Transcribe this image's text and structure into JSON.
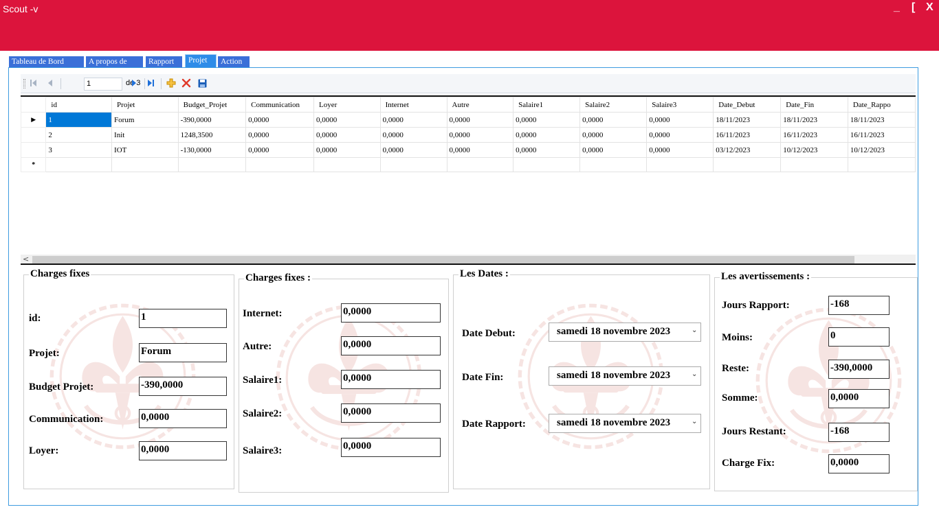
{
  "window": {
    "title": "Scout -v",
    "minimize": "_",
    "restore": "[",
    "close": "X"
  },
  "tabs": [
    {
      "label": "Tableau de Bord"
    },
    {
      "label": "A propos de"
    },
    {
      "label": "Rapport"
    },
    {
      "label": "Projet"
    },
    {
      "label": "Action"
    }
  ],
  "active_tab": "Projet",
  "navigator": {
    "position": "1",
    "of_label": "de 3"
  },
  "grid": {
    "columns": [
      "id",
      "Projet",
      "Budget_Projet",
      "Communication",
      "Loyer",
      "Internet",
      "Autre",
      "Salaire1",
      "Salaire2",
      "Salaire3",
      "Date_Debut",
      "Date_Fin",
      "Date_Rappo"
    ],
    "rows": [
      [
        "1",
        "Forum",
        "-390,0000",
        "0,0000",
        "0,0000",
        "0,0000",
        "0,0000",
        "0,0000",
        "0,0000",
        "0,0000",
        "18/11/2023",
        "18/11/2023",
        "18/11/2023"
      ],
      [
        "2",
        "Init",
        "1248,3500",
        "0,0000",
        "0,0000",
        "0,0000",
        "0,0000",
        "0,0000",
        "0,0000",
        "0,0000",
        "16/11/2023",
        "16/11/2023",
        "16/11/2023"
      ],
      [
        "3",
        "IOT",
        "-130,0000",
        "0,0000",
        "0,0000",
        "0,0000",
        "0,0000",
        "0,0000",
        "0,0000",
        "0,0000",
        "03/12/2023",
        "10/12/2023",
        "10/12/2023"
      ]
    ],
    "current_row_marker": "▶",
    "new_row_marker": "*"
  },
  "group1": {
    "title": "Charges fixes",
    "fields": [
      {
        "label": "id:",
        "value": "1"
      },
      {
        "label": "Projet:",
        "value": "Forum"
      },
      {
        "label": "Budget Projet:",
        "value": "-390,0000"
      },
      {
        "label": "Communication:",
        "value": "0,0000"
      },
      {
        "label": "Loyer:",
        "value": "0,0000"
      }
    ]
  },
  "group2": {
    "title": "Charges fixes :",
    "fields": [
      {
        "label": "Internet:",
        "value": "0,0000"
      },
      {
        "label": "Autre:",
        "value": "0,0000"
      },
      {
        "label": "Salaire1:",
        "value": "0,0000"
      },
      {
        "label": "Salaire2:",
        "value": "0,0000"
      },
      {
        "label": "Salaire3:",
        "value": "0,0000"
      }
    ]
  },
  "group3": {
    "title": "Les Dates :",
    "fields": [
      {
        "label": "Date Debut:",
        "value": "samedi   18 novembre  2023"
      },
      {
        "label": "Date Fin:",
        "value": "samedi   18 novembre  2023"
      },
      {
        "label": "Date Rapport:",
        "value": "samedi   18 novembre  2023"
      }
    ]
  },
  "group4": {
    "title": "Les avertissements :",
    "fields": [
      {
        "label": "Jours Rapport:",
        "value": "-168"
      },
      {
        "label": "Moins:",
        "value": "0"
      },
      {
        "label": "Reste:",
        "value": "-390,0000"
      },
      {
        "label": "Somme:",
        "value": "0,0000"
      },
      {
        "label": "Jours Restant:",
        "value": "-168"
      },
      {
        "label": "Charge Fix:",
        "value": "0,0000"
      }
    ]
  },
  "colors": {
    "titlebar": "#dc143c",
    "tab": "#3a6fd8",
    "selection": "#0078d7",
    "emblem": "#c0392b"
  }
}
